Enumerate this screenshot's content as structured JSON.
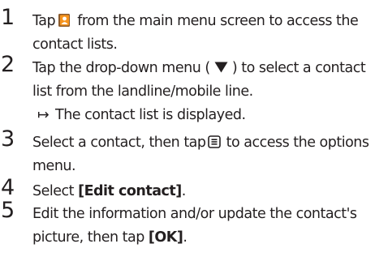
{
  "steps": [
    {
      "number": "1",
      "pre": "Tap",
      "icon": "contacts-book-icon",
      "post": "from the main menu screen to access the contact lists."
    },
    {
      "number": "2",
      "pre": "Tap the drop-down menu (",
      "icon": "triangle-down-icon",
      "post": ") to select a contact list from the landline/mobile line.",
      "result": "The contact list is displayed.",
      "result_icon": "right-arrow-icon"
    },
    {
      "number": "3",
      "pre": "Select a contact, then tap",
      "icon": "options-menu-icon",
      "post": "to access the options menu."
    },
    {
      "number": "4",
      "pre": "Select",
      "bold": "[Edit contact]",
      "post": "."
    },
    {
      "number": "5",
      "pre": "Edit the information and/or update the contact's picture, then tap",
      "bold": "[OK]",
      "post": "."
    }
  ],
  "colors": {
    "text": "#231f20",
    "icon_orange": "#f7941d",
    "icon_brown": "#8b5a2b"
  }
}
